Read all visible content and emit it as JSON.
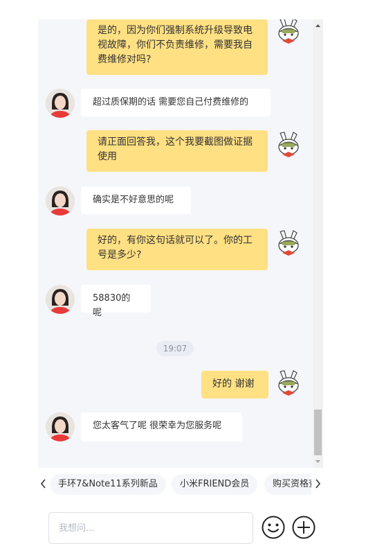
{
  "messages": [
    {
      "from": "user",
      "text": "是的，因为你们强制系统升级导致电视故障，你们不负责维修，需要我自费维修对吗?"
    },
    {
      "from": "agent",
      "text": "超过质保期的话 需要您自己付费维修的"
    },
    {
      "from": "user",
      "text": "请正面回答我，这个我要截图做证据使用"
    },
    {
      "from": "agent",
      "text": "确实是不好意思的呢"
    },
    {
      "from": "user",
      "text": "好的，有你这句话就可以了。你的工号是多少?"
    },
    {
      "from": "agent",
      "text": "58830的呢"
    },
    {
      "from": "user",
      "text": "好的 谢谢"
    },
    {
      "from": "agent",
      "text": "您太客气了呢 很荣幸为您服务呢"
    }
  ],
  "timestamp": "19:07",
  "quick_chips": [
    "手环7&Note11系列新品",
    "小米FRIEND会员",
    "购买资格查询"
  ],
  "input": {
    "placeholder": "我想问..."
  },
  "icons": {
    "scroll_up": "arrow-up-icon",
    "scroll_down": "arrow-down-icon",
    "chips_prev": "chevron-left-icon",
    "chips_next": "chevron-right-icon",
    "emoji": "emoji-icon",
    "add": "plus-circle-icon"
  },
  "colors": {
    "user_bubble": "#ffe083",
    "agent_bubble": "#ffffff",
    "chat_bg": "#f4f6fa",
    "agent_shirt": "#e83a3a"
  }
}
